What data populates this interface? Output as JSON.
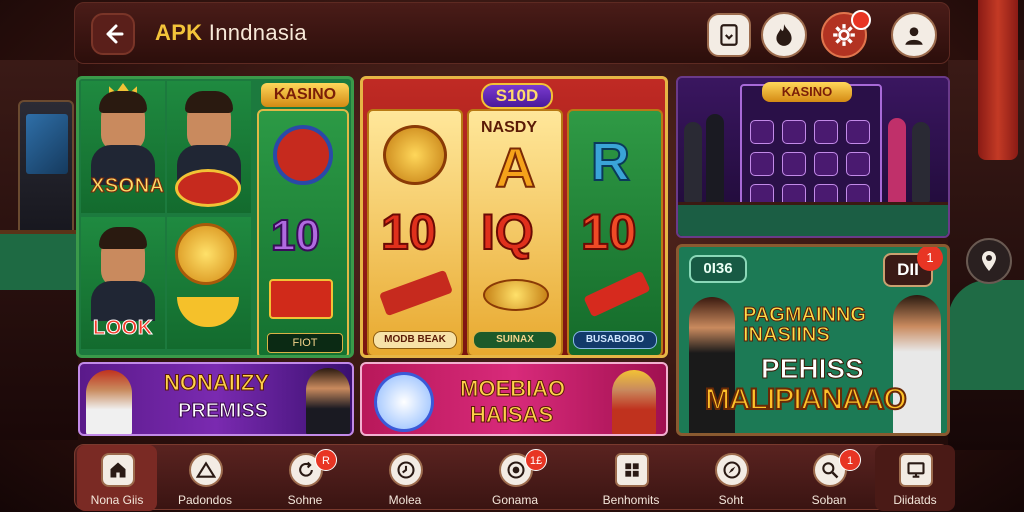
{
  "app": {
    "title_part1": "APK",
    "title_part2": "Inndnasia"
  },
  "topbar": {
    "back_icon": "arrow-left-icon",
    "buttons": [
      {
        "name": "wallet-button",
        "icon": "wallet-icon"
      },
      {
        "name": "fire-button",
        "icon": "fire-icon"
      },
      {
        "name": "settings-button",
        "icon": "gear-icon",
        "badge": true
      },
      {
        "name": "profile-button",
        "icon": "user-icon"
      }
    ]
  },
  "games": {
    "panel1": {
      "tag": "KASINO",
      "labels": [
        "XSONA",
        "LOOK"
      ],
      "reel_value": "10",
      "reel_caption": "FIOT"
    },
    "panel2": {
      "tag": "S10D",
      "col_labels": [
        "NASDY"
      ],
      "values": [
        "10",
        "IQ",
        "10"
      ],
      "captions": [
        "MODB BEAK",
        "SUINAX",
        "BUSABOBO"
      ]
    },
    "panel3": {
      "tag": "KASINO"
    },
    "panel4": {
      "pill": "0I36",
      "pill2": "DII",
      "badge": "1",
      "line1": "PAGMAINNG",
      "line1b": "INASIINS",
      "line2": "PEHISS",
      "line3": "MALIPIANAAO"
    }
  },
  "banners": {
    "left": {
      "title": "NONAIIZY",
      "subtitle": "PREMISS"
    },
    "middle": {
      "title": "MOEBIAO",
      "subtitle": "HAISAS"
    }
  },
  "nav": [
    {
      "label": "Nona Giis",
      "icon": "home-icon",
      "active": true
    },
    {
      "label": "Padondos",
      "icon": "tent-icon"
    },
    {
      "label": "Sohne",
      "icon": "refresh-icon",
      "badge": "R"
    },
    {
      "label": "Molea",
      "icon": "clock-icon"
    },
    {
      "label": "Gonama",
      "icon": "casino-chip-icon",
      "badge": "1£"
    },
    {
      "label": "Benhomits",
      "icon": "grid-icon"
    },
    {
      "label": "Soht",
      "icon": "compass-icon"
    },
    {
      "label": "Soban",
      "icon": "search-icon",
      "badge": "1"
    },
    {
      "label": "Diidatds",
      "icon": "monitor-icon"
    }
  ]
}
